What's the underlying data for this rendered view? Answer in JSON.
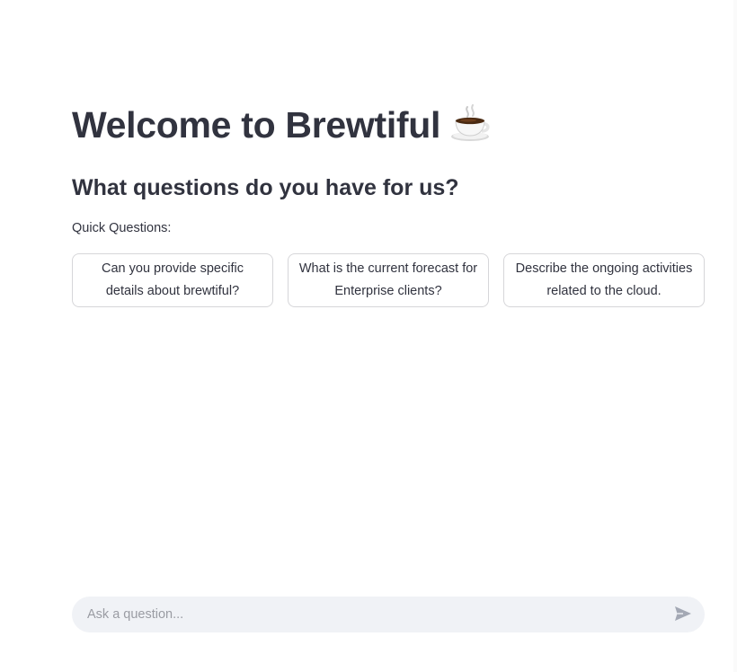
{
  "header": {
    "title": "Welcome to Brewtiful",
    "title_icon": "coffee-cup-icon"
  },
  "main": {
    "subtitle": "What questions do you have for us?",
    "quick_questions_label": "Quick Questions:",
    "quick_questions": [
      {
        "label": "Can you provide specific details about brewtiful?"
      },
      {
        "label": "What is the current forecast for Enterprise clients?"
      },
      {
        "label": "Describe the ongoing activities related to the cloud."
      }
    ]
  },
  "chat": {
    "placeholder": "Ask a question...",
    "value": "",
    "send_icon": "send-icon"
  },
  "colors": {
    "text": "#31333f",
    "border": "#d6d6d9",
    "input_bg": "#f0f2f6",
    "placeholder": "#9a9ca3",
    "send_icon": "#a3a8b4"
  }
}
